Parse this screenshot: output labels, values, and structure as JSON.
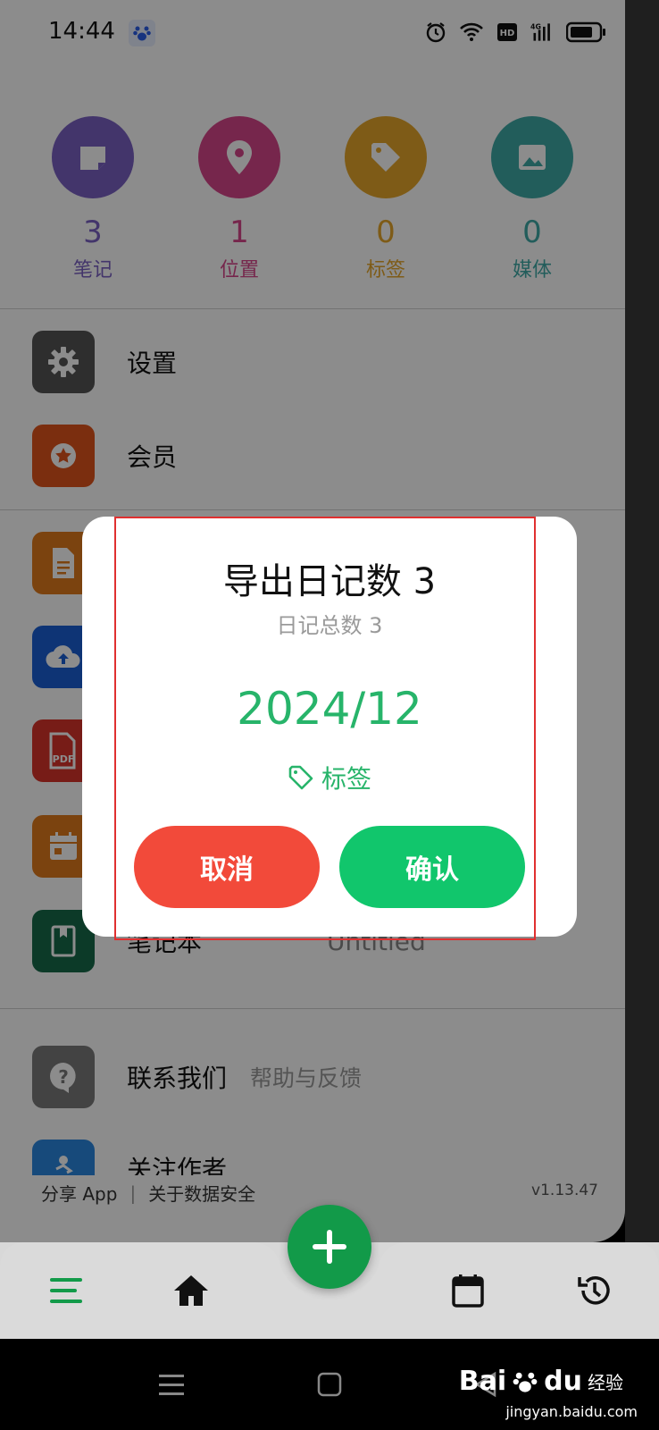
{
  "status_bar": {
    "time": "14:44"
  },
  "stats": [
    {
      "count": "3",
      "label": "笔记",
      "color": "#7b61c4",
      "icon": "note-icon"
    },
    {
      "count": "1",
      "label": "位置",
      "color": "#d8468a",
      "icon": "location-pin-icon"
    },
    {
      "count": "0",
      "label": "标签",
      "color": "#e6a72a",
      "icon": "tag-icon"
    },
    {
      "count": "0",
      "label": "媒体",
      "color": "#3fa9a6",
      "icon": "image-icon"
    }
  ],
  "menu": {
    "settings": "设置",
    "membership": "会员",
    "notebook": "笔记本",
    "notebook_value": "Untitled",
    "contact": "联系我们",
    "contact_sub": "帮助与反馈",
    "follow": "关注作者"
  },
  "footer": {
    "share": "分享 App",
    "data_safety": "关于数据安全",
    "version": "v1.13.47"
  },
  "dialog": {
    "title": "导出日记数 3",
    "subtitle": "日记总数 3",
    "date": "2024/12",
    "tag_label": "标签",
    "cancel": "取消",
    "confirm": "确认"
  },
  "watermark": {
    "brand": "Bai",
    "brand2": "du",
    "cn": "经验",
    "url": "jingyan.baidu.com"
  },
  "colors": {
    "accent_green": "#27b46a",
    "cancel_red": "#f24a3a",
    "confirm_green": "#11c66c"
  }
}
